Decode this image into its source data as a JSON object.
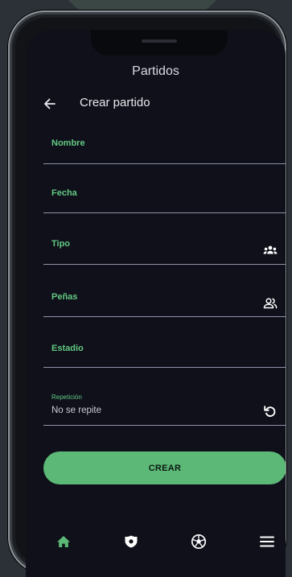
{
  "app": {
    "title": "Partidos"
  },
  "header": {
    "title": "Crear partido",
    "back_icon": "arrow-left-icon"
  },
  "form": {
    "fields": [
      {
        "label": "Nombre",
        "value": ""
      },
      {
        "label": "Fecha",
        "value": ""
      },
      {
        "label": "Tipo",
        "value": "",
        "icon": "group-icon"
      },
      {
        "label": "Peñas",
        "value": "",
        "icon": "people-icon"
      },
      {
        "label": "Estadio",
        "value": ""
      },
      {
        "label": "Repetición",
        "value": "No se repite",
        "icon": "repeat-icon"
      }
    ],
    "submit_label": "CREAR"
  },
  "bottom_nav": {
    "items": [
      {
        "icon": "home-icon",
        "active": true
      },
      {
        "icon": "shield-icon",
        "active": false
      },
      {
        "icon": "soccer-ball-icon",
        "active": false
      },
      {
        "icon": "menu-icon",
        "active": false
      }
    ]
  },
  "colors": {
    "accent": "#63c882",
    "button": "#5cb876",
    "background": "#0f101a",
    "divider": "#8d93a5"
  }
}
